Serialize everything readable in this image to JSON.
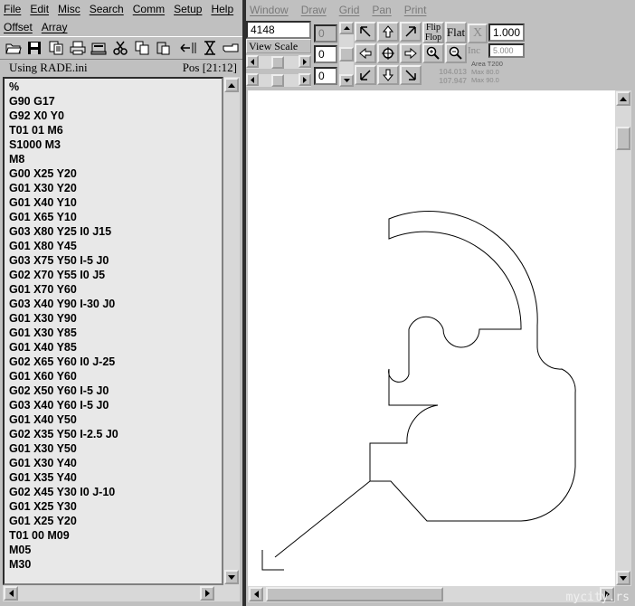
{
  "editor_window": {
    "menu_row1": [
      "File",
      "Edit",
      "Misc",
      "Search",
      "Comm",
      "Setup",
      "Help"
    ],
    "menu_row2": [
      "Offset",
      "Array"
    ],
    "config_label": "Using RADE.ini",
    "position": "Pos [21:12]",
    "code_lines": [
      "%",
      "G90 G17",
      "G92 X0 Y0",
      "T01 01 M6",
      "S1000 M3",
      "M8",
      "G00 X25 Y20",
      "G01 X30 Y20",
      "G01 X40 Y10",
      "G01 X65 Y10",
      "G03 X80 Y25 I0 J15",
      "G01 X80 Y45",
      "G03 X75 Y50 I-5 J0",
      "G02 X70 Y55 I0 J5",
      "G01 X70 Y60",
      "G03 X40 Y90 I-30 J0",
      "G01 X30 Y90",
      "G01 X30 Y85",
      "G01 X40 Y85",
      "G02 X65 Y60 I0 J-25",
      "G01 X60 Y60",
      "G02 X50 Y60 I-5 J0",
      "G03 X40 Y60 I-5 J0",
      "G01 X40 Y50",
      "G02 X35 Y50 I-2.5 J0",
      "G01 X30 Y50",
      "G01 X30 Y40",
      "G01 X35 Y40",
      "G02 X45 Y30 I0 J-10",
      "G01 X25 Y30",
      "G01 X25 Y20",
      "T01 00 M09",
      "M05",
      "M30"
    ]
  },
  "draw_window": {
    "menu": [
      "Window",
      "Draw",
      "Grid",
      "Pan",
      "Print"
    ],
    "count_value": "4148",
    "view_scale_label": "View Scale",
    "offset_values": [
      "0",
      "0",
      "0"
    ],
    "flip_label_1": "Flip",
    "flip_label_2": "Flop",
    "flat_label": "Flat",
    "x_label": "X",
    "x_value": "1.000",
    "inc_label": "Inc",
    "inc_value": "5.000",
    "coord_x": "104.013",
    "coord_y": "107.947",
    "area_label": "Area T200",
    "max_x": "Max 80.0",
    "max_y": "Max 90.0"
  },
  "watermark": "mycity.rs"
}
